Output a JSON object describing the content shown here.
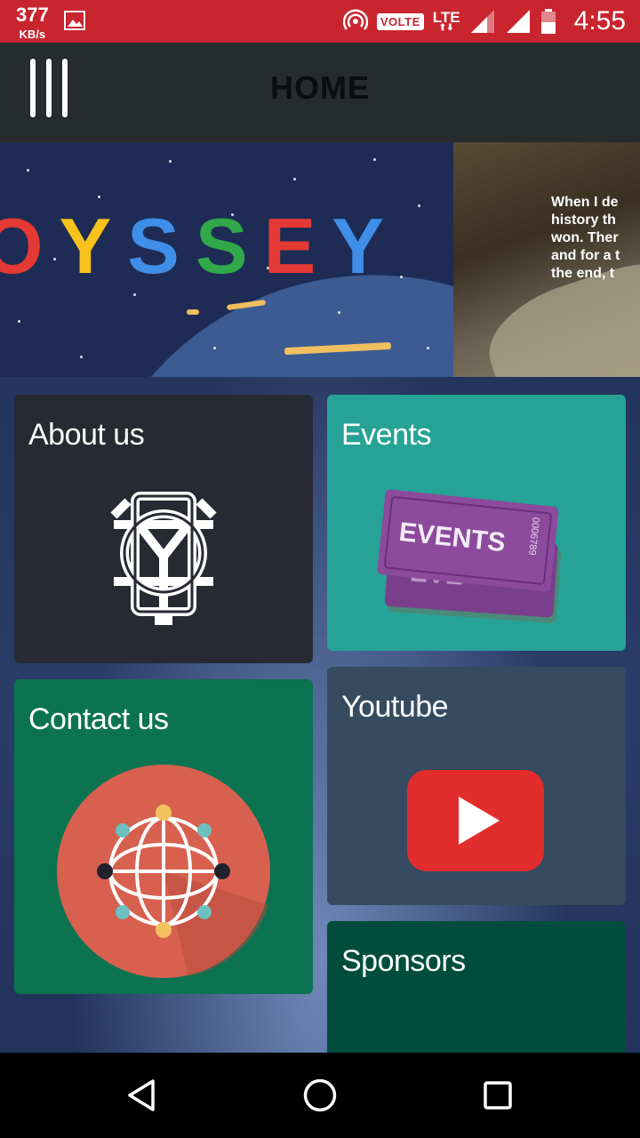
{
  "status_bar": {
    "net_speed": "377",
    "net_unit": "KB/s",
    "volte": "VOLTE",
    "network": "LTE",
    "time": "4:55"
  },
  "app_bar": {
    "title": "HOME",
    "menu_icon": "menu-icon"
  },
  "banner": {
    "logo_letters": [
      "O",
      "Y",
      "S",
      "S",
      "E",
      "Y"
    ],
    "quote_lines": [
      "When I de",
      "history th",
      "won. Ther",
      "and for a t",
      "the end, t"
    ]
  },
  "tiles": {
    "about": {
      "label": "About us",
      "icon": "odyssey-monogram-icon",
      "color": "#272a33"
    },
    "events": {
      "label": "Events",
      "icon": "event-tickets-icon",
      "ticket_text": "EVENTS",
      "ticket_serial": "0006789",
      "color": "#26a396"
    },
    "contact": {
      "label": "Contact us",
      "icon": "globe-network-icon",
      "color": "#0b7350"
    },
    "youtube": {
      "label": "Youtube",
      "icon": "youtube-play-icon",
      "color": "#364a60"
    },
    "sponsors": {
      "label": "Sponsors",
      "color": "#004d3d"
    }
  },
  "nav_bar": {
    "back": "back-icon",
    "home": "home-icon",
    "recents": "recents-icon"
  },
  "colors": {
    "status_bar": "#c9252f",
    "app_bar": "#262b2d",
    "youtube_red": "#e22d2d"
  }
}
